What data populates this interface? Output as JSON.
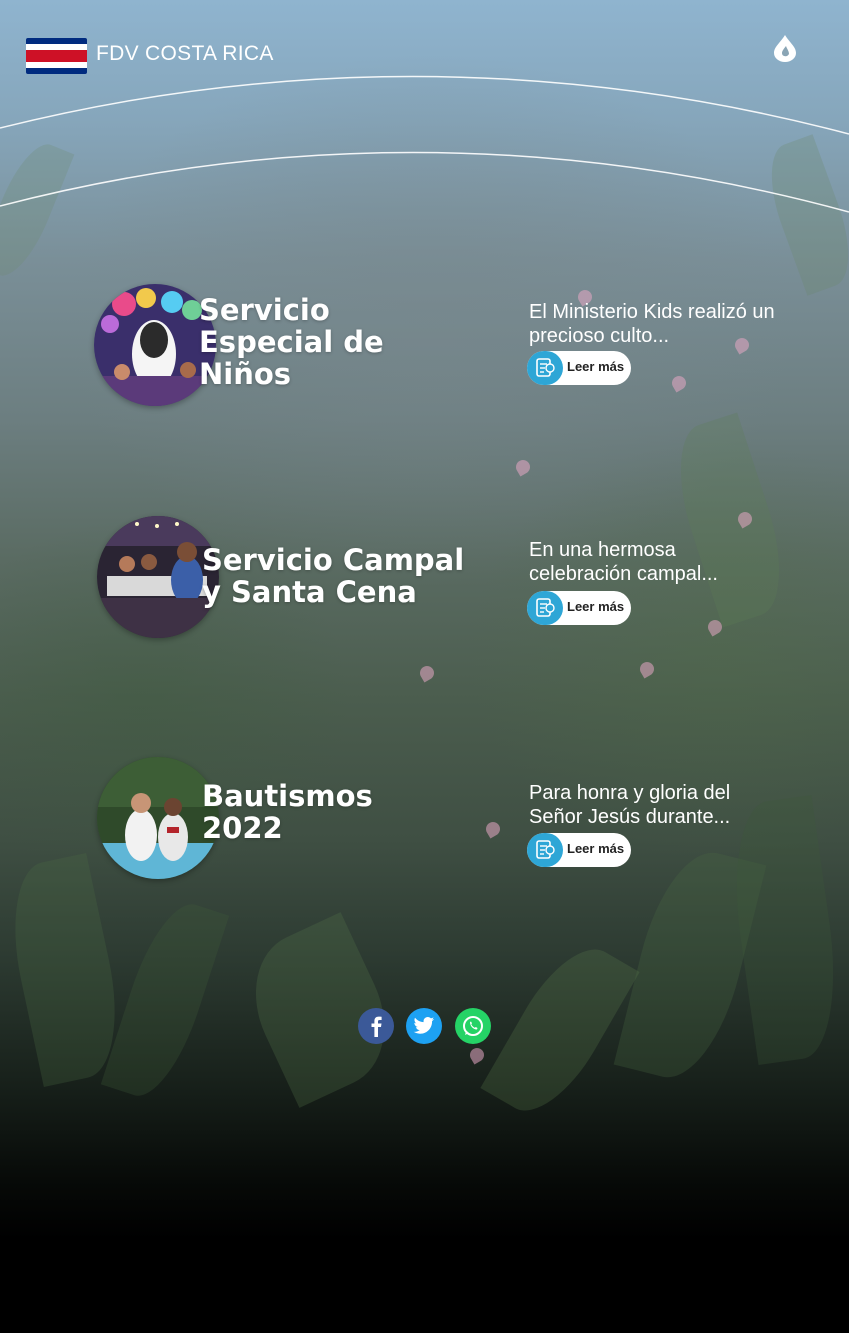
{
  "header": {
    "site_title": "FDV COSTA RICA",
    "flag_colors": [
      "#002b7f",
      "#ffffff",
      "#ce1126",
      "#ffffff",
      "#002b7f"
    ],
    "logo_icon": "flame-drop-icon"
  },
  "articles": [
    {
      "title_lines": [
        "Servicio",
        "Especial de",
        "Niños"
      ],
      "excerpt": "El Ministerio Kids realizó un precioso culto...",
      "button_label": "Leer más",
      "image": "kids-service-photo"
    },
    {
      "title_lines": [
        "Servicio Campal",
        "y Santa Cena"
      ],
      "excerpt": "En una hermosa celebración campal...",
      "button_label": "Leer más",
      "image": "campal-service-photo"
    },
    {
      "title_lines": [
        "Bautismos",
        "2022"
      ],
      "excerpt": "Para honra y gloria del Señor Jesús durante...",
      "button_label": "Leer más",
      "image": "baptism-photo"
    }
  ],
  "social": {
    "facebook": {
      "icon": "facebook-icon",
      "color": "#3b5998"
    },
    "twitter": {
      "icon": "twitter-icon",
      "color": "#1da1f2"
    },
    "whatsapp": {
      "icon": "whatsapp-icon",
      "color": "#25d366"
    }
  },
  "colors": {
    "accent": "#2ea6d6",
    "text": "#ffffff"
  }
}
